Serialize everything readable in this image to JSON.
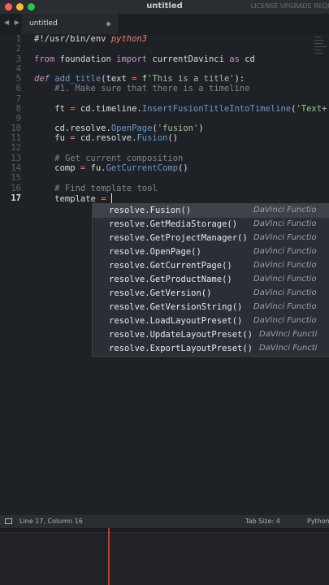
{
  "window": {
    "title": "untitled",
    "license_text": "LICENSE UPGRADE REQU"
  },
  "tabbar": {
    "nav_arrows": "◀ ▶",
    "active_tab_label": "untitled"
  },
  "editor": {
    "line_numbers": [
      "1",
      "2",
      "3",
      "4",
      "5",
      "6",
      "7",
      "8",
      "9",
      "10",
      "11",
      "12",
      "13",
      "14",
      "15",
      "16",
      "17"
    ],
    "active_line": "17",
    "lines": {
      "l1_shebang": "#!/usr/bin/env ",
      "l1_python": "python3",
      "l3_from": "from",
      "l3_module": " foundation ",
      "l3_import": "import",
      "l3_name": " currentDavinci ",
      "l3_as": "as",
      "l3_alias": " cd",
      "l5_def": "def",
      "l5_space": " ",
      "l5_fname": "add_title",
      "l5_paren": "(text ",
      "l5_eq": "=",
      "l5_fprefix": " f",
      "l5_str": "'This is a title'",
      "l5_close": "):",
      "l6_comment": "#1. Make sure that there is a timeline",
      "l8_indent": "    ft ",
      "l8_eq": "=",
      "l8_obj": " cd.timeline.",
      "l8_fn": "InsertFusionTitleIntoTimeline",
      "l8_open": "(",
      "l8_str": "'Text+",
      "l10_obj": "    cd.resolve.",
      "l10_fn": "OpenPage",
      "l10_open": "(",
      "l10_str": "'fusion'",
      "l10_close": ")",
      "l11_indent": "    fu ",
      "l11_eq": "=",
      "l11_obj": " cd.resolve.",
      "l11_fn": "Fusion",
      "l11_close": "()",
      "l13_comment": "# Get current composition",
      "l14_indent": "    comp ",
      "l14_eq": "=",
      "l14_obj": " fu.",
      "l14_fn": "GetCurrentComp",
      "l14_close": "()",
      "l16_comment": "# Find template tool",
      "l17_indent": "    template ",
      "l17_eq": "="
    }
  },
  "autocomplete": {
    "selected_index": 0,
    "items": [
      {
        "name": "resolve.Fusion()",
        "kind": "DaVinci Functio"
      },
      {
        "name": "resolve.GetMediaStorage()",
        "kind": "DaVinci Functio"
      },
      {
        "name": "resolve.GetProjectManager()",
        "kind": "DaVinci Functio"
      },
      {
        "name": "resolve.OpenPage()",
        "kind": "DaVinci Functio"
      },
      {
        "name": "resolve.GetCurrentPage()",
        "kind": "DaVinci Functio"
      },
      {
        "name": "resolve.GetProductName()",
        "kind": "DaVinci Functio"
      },
      {
        "name": "resolve.GetVersion()",
        "kind": "DaVinci Functio"
      },
      {
        "name": "resolve.GetVersionString()",
        "kind": "DaVinci Functio"
      },
      {
        "name": "resolve.LoadLayoutPreset()",
        "kind": "DaVinci Functio"
      },
      {
        "name": "resolve.UpdateLayoutPreset()",
        "kind": "DaVinci Functi"
      },
      {
        "name": "resolve.ExportLayoutPreset()",
        "kind": "DaVinci Functi"
      }
    ]
  },
  "statusbar": {
    "position": "Line 17, Column 16",
    "tab_size": "Tab Size: 4",
    "language": "Python"
  },
  "icons": {
    "close": "close-button-icon",
    "minimize": "minimize-button-icon",
    "maximize": "maximize-button-icon",
    "panel_toggle": "panel-toggle-icon"
  },
  "colors": {
    "background": "#1e2227",
    "keyword": "#c594c5",
    "string": "#99c794",
    "function": "#6699cc",
    "operator": "#f97b58",
    "comment": "#7f848a",
    "playhead": "#d33131"
  }
}
